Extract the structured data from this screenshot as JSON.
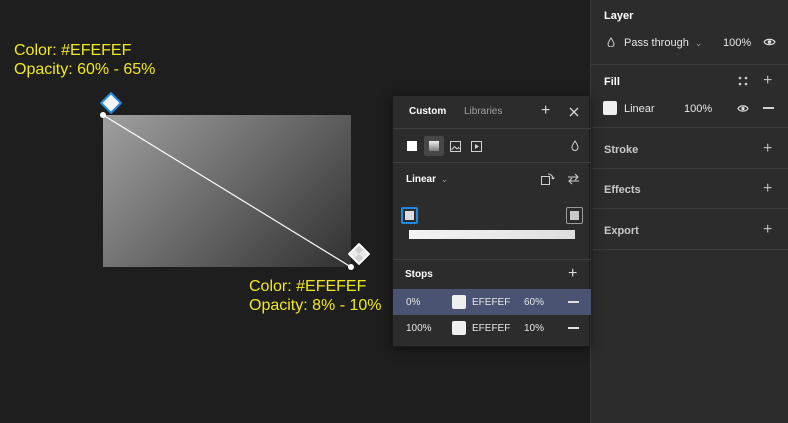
{
  "annotations": {
    "top": {
      "color_line": "Color: #EFEFEF",
      "opacity_line": "Opacity: 60% - 65%"
    },
    "bottom": {
      "color_line": "Color: #EFEFEF",
      "opacity_line": "Opacity: 8% - 10%"
    }
  },
  "colors": {
    "annotation": "#F0E81E",
    "selection": "#4A5372",
    "accent": "#1E88E5",
    "fill": "#EFEFEF"
  },
  "layer": {
    "title": "Layer",
    "blend_mode": "Pass through",
    "opacity": "100%"
  },
  "fill": {
    "title": "Fill",
    "type": "Linear",
    "opacity": "100%"
  },
  "sections": {
    "stroke": "Stroke",
    "effects": "Effects",
    "export": "Export"
  },
  "popup": {
    "tabs": {
      "custom": "Custom",
      "libraries": "Libraries"
    },
    "gradient_type": "Linear",
    "stops_title": "Stops",
    "stops": [
      {
        "position": "0%",
        "hex": "EFEFEF",
        "opacity": "60%"
      },
      {
        "position": "100%",
        "hex": "EFEFEF",
        "opacity": "10%"
      }
    ]
  }
}
